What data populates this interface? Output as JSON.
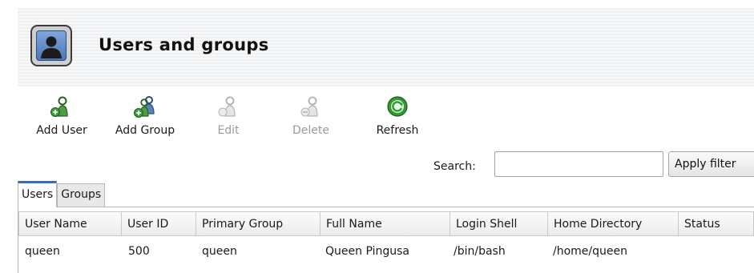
{
  "header": {
    "title": "Users and groups",
    "icon": "users-groups-icon"
  },
  "toolbar": {
    "items": [
      {
        "label": "Add User",
        "icon": "add-user-icon",
        "enabled": true
      },
      {
        "label": "Add Group",
        "icon": "add-group-icon",
        "enabled": true
      },
      {
        "label": "Edit",
        "icon": "edit-icon",
        "enabled": false
      },
      {
        "label": "Delete",
        "icon": "delete-icon",
        "enabled": false
      },
      {
        "label": "Refresh",
        "icon": "refresh-icon",
        "enabled": true
      }
    ]
  },
  "search": {
    "label": "Search:",
    "value": "",
    "apply_label": "Apply filter"
  },
  "tabs": [
    {
      "label": "Users",
      "active": true
    },
    {
      "label": "Groups",
      "active": false
    }
  ],
  "table": {
    "columns": [
      "User Name",
      "User ID",
      "Primary Group",
      "Full Name",
      "Login Shell",
      "Home Directory",
      "Status"
    ],
    "rows": [
      [
        "queen",
        "500",
        "queen",
        "Queen Pingusa",
        "/bin/bash",
        "/home/queen",
        ""
      ]
    ]
  },
  "colors": {
    "accent": "#3a6fb0",
    "refresh_green": "#2f9a2f",
    "user_icon_green": "#3f8f3a"
  }
}
